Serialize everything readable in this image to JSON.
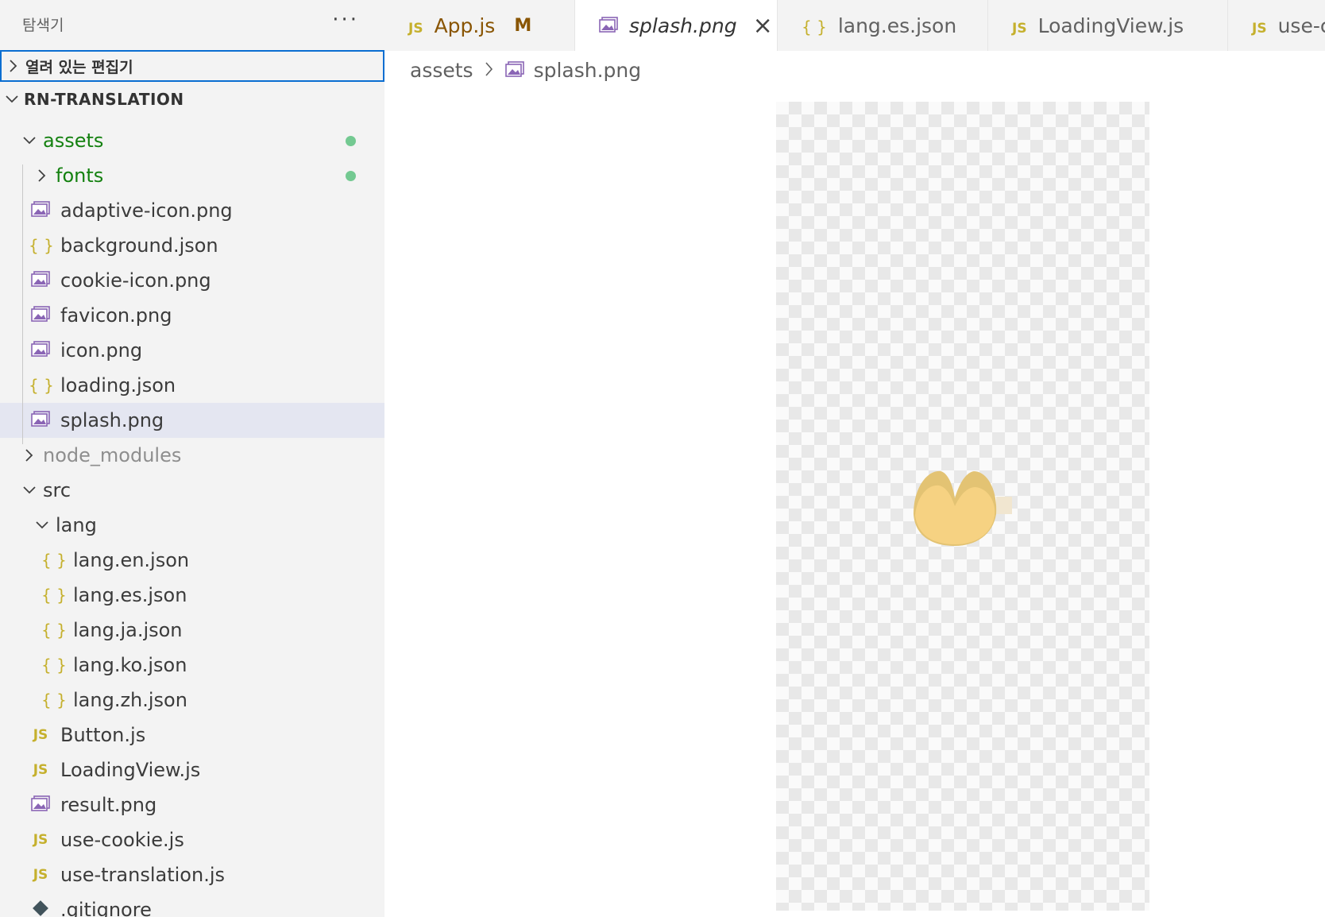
{
  "sidebar": {
    "title": "탐색기",
    "more_icon": "ellipsis-icon",
    "open_editors_label": "열려 있는 편집기",
    "project_name": "RN-TRANSLATION",
    "tree": [
      {
        "name": "assets",
        "type": "folder",
        "expanded": true,
        "git": "green",
        "dot": true
      },
      {
        "name": "fonts",
        "type": "folder",
        "expanded": false,
        "git": "green",
        "dot": true
      },
      {
        "name": "adaptive-icon.png",
        "type": "image"
      },
      {
        "name": "background.json",
        "type": "json"
      },
      {
        "name": "cookie-icon.png",
        "type": "image"
      },
      {
        "name": "favicon.png",
        "type": "image"
      },
      {
        "name": "icon.png",
        "type": "image"
      },
      {
        "name": "loading.json",
        "type": "json"
      },
      {
        "name": "splash.png",
        "type": "image",
        "selected": true
      },
      {
        "name": "node_modules",
        "type": "folder",
        "expanded": false,
        "git": "ignored"
      },
      {
        "name": "src",
        "type": "folder",
        "expanded": true
      },
      {
        "name": "lang",
        "type": "folder",
        "expanded": true
      },
      {
        "name": "lang.en.json",
        "type": "json"
      },
      {
        "name": "lang.es.json",
        "type": "json"
      },
      {
        "name": "lang.ja.json",
        "type": "json"
      },
      {
        "name": "lang.ko.json",
        "type": "json"
      },
      {
        "name": "lang.zh.json",
        "type": "json"
      },
      {
        "name": "Button.js",
        "type": "js"
      },
      {
        "name": "LoadingView.js",
        "type": "js"
      },
      {
        "name": "result.png",
        "type": "image"
      },
      {
        "name": "use-cookie.js",
        "type": "js"
      },
      {
        "name": "use-translation.js",
        "type": "js"
      },
      {
        "name": ".gitignore",
        "type": "git"
      }
    ]
  },
  "tabs": [
    {
      "label": "App.js",
      "type": "js",
      "modified": "M"
    },
    {
      "label": "splash.png",
      "type": "image",
      "active": true
    },
    {
      "label": "lang.es.json",
      "type": "json"
    },
    {
      "label": "LoadingView.js",
      "type": "js"
    },
    {
      "label": "use-cookie.js",
      "type": "js"
    }
  ],
  "breadcrumb": {
    "folder": "assets",
    "file": "splash.png"
  },
  "icon_glyphs": {
    "js": "JS",
    "json": "{ }"
  },
  "colors": {
    "accent": "#0a6ed1",
    "git_added": "#148110",
    "dot": "#73c991",
    "selection": "#e4e6f1",
    "js_icon": "#c5b02d",
    "image_icon": "#8a65b5",
    "splash_fill": "#f6d282"
  }
}
